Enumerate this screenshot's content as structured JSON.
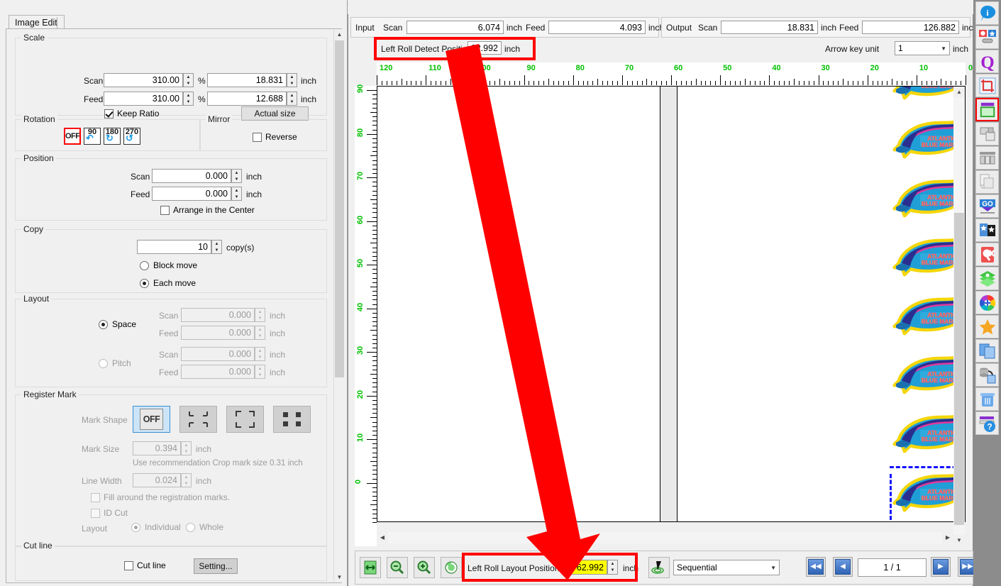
{
  "left_panel": {
    "tab_label": "Image Edit",
    "scale": {
      "title": "Scale",
      "scan_label": "Scan",
      "scan_percent": "310.00",
      "percent_unit": "%",
      "scan_size": "18.831",
      "feed_label": "Feed",
      "feed_percent": "310.00",
      "feed_size": "12.688",
      "inch": "inch",
      "keep_ratio_label": "Keep Ratio",
      "keep_ratio_checked": true,
      "actual_size_label": "Actual size"
    },
    "rotation": {
      "title": "Rotation",
      "options": [
        "OFF",
        "90",
        "180",
        "270"
      ],
      "selected": "OFF"
    },
    "mirror": {
      "title": "Mirror",
      "reverse_label": "Reverse",
      "reverse_checked": false
    },
    "position": {
      "title": "Position",
      "scan_label": "Scan",
      "scan_value": "0.000",
      "feed_label": "Feed",
      "feed_value": "0.000",
      "inch": "inch",
      "arrange_label": "Arrange in the Center",
      "arrange_checked": false
    },
    "copy": {
      "title": "Copy",
      "count": "10",
      "count_unit": "copy(s)",
      "block_move_label": "Block move",
      "each_move_label": "Each move",
      "selected": "Each move"
    },
    "layout": {
      "title": "Layout",
      "space_label": "Space",
      "pitch_label": "Pitch",
      "selected": "Space",
      "space_scan_label": "Scan",
      "space_scan_value": "0.000",
      "space_feed_label": "Feed",
      "space_feed_value": "0.000",
      "pitch_scan_label": "Scan",
      "pitch_scan_value": "0.000",
      "pitch_feed_label": "Feed",
      "pitch_feed_value": "0.000",
      "inch": "inch"
    },
    "register_mark": {
      "title": "Register Mark",
      "mark_shape_label": "Mark Shape",
      "shape_selected": "OFF",
      "shape_off_label": "OFF",
      "mark_size_label": "Mark Size",
      "mark_size_value": "0.394",
      "recommendation": "Use recommendation Crop mark size  0.31 inch",
      "line_width_label": "Line Width",
      "line_width_value": "0.024",
      "inch": "inch",
      "fill_label": "Fill around the registration marks.",
      "fill_checked": false,
      "id_cut_label": "ID Cut",
      "id_cut_checked": false,
      "layout_label": "Layout",
      "individual_label": "Individual",
      "whole_label": "Whole",
      "layout_selected": "Individual"
    },
    "cut_line": {
      "title": "Cut line",
      "checkbox_label": "Cut line",
      "checked": false,
      "setting_label": "Setting..."
    }
  },
  "io_bar": {
    "input_label": "Input",
    "input_scan_label": "Scan",
    "input_scan_value": "6.074",
    "input_feed_label": "Feed",
    "input_feed_value": "4.093",
    "output_label": "Output",
    "output_scan_label": "Scan",
    "output_scan_value": "18.831",
    "output_feed_label": "Feed",
    "output_feed_value": "126.882",
    "inch": "inch",
    "left_roll_detect_label": "Left Roll Detect Positio",
    "left_roll_detect_value": "62.992",
    "arrow_key_unit_label": "Arrow key unit",
    "arrow_key_unit_value": "1"
  },
  "rulers": {
    "horizontal_labels": [
      "120",
      "110",
      "100",
      "90",
      "80",
      "70",
      "60",
      "50",
      "40",
      "30",
      "20",
      "10",
      "0"
    ],
    "vertical_labels": [
      "90",
      "80",
      "70",
      "60",
      "50",
      "40",
      "30",
      "20",
      "10",
      "0"
    ],
    "tick_color": "#00c000"
  },
  "canvas": {
    "artwork_name": "atlantic-blue-marlin",
    "artwork_text_line1": "ATLANTIC",
    "artwork_text_line2": "BLUE MARLIN",
    "copies_visible": 9,
    "selection_color": "#1414ff"
  },
  "bottom_bar": {
    "fit_label": "fit-page-icon",
    "zoom_out_label": "zoom-out-icon",
    "zoom_in_label": "zoom-in-icon",
    "refresh_label": "refresh-icon",
    "left_roll_layout_label": "Left Roll Layout Position",
    "left_roll_layout_value": "62.992",
    "inch": "inch",
    "origin_label": "origin-point-icon",
    "order_mode": "Sequential",
    "page_indicator": "1 / 1",
    "first_label": "first-page",
    "prev_label": "previous-page",
    "next_label": "next-page",
    "last_label": "last-page"
  },
  "rail": {
    "icons": [
      "info-icon",
      "media-settings-icon",
      "quality-icon",
      "crop-icon",
      "print-area-icon",
      "printer-icon",
      "nesting-icon",
      "copy-layers-icon",
      "go-icon",
      "favorite-add-icon",
      "quick-cancel-icon",
      "layers-icon",
      "color-wheel-icon",
      "star-icon",
      "duplicate-icon",
      "database-send-icon",
      "delete-icon",
      "help-icon"
    ],
    "selected_index": 4
  },
  "highlight": {
    "color": "#ff0000",
    "arrow_name": "annotation-arrow"
  }
}
